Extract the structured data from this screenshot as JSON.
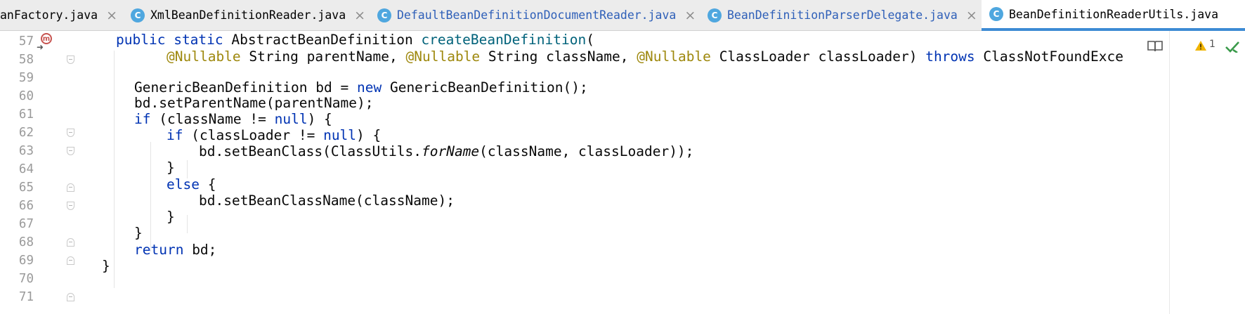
{
  "tabs": [
    {
      "label": "anFactory.java",
      "has_icon": false,
      "icon_letter": "",
      "active": false,
      "blue": false
    },
    {
      "label": "XmlBeanDefinitionReader.java",
      "has_icon": true,
      "icon_letter": "C",
      "active": false,
      "blue": false
    },
    {
      "label": "DefaultBeanDefinitionDocumentReader.java",
      "has_icon": true,
      "icon_letter": "C",
      "active": false,
      "blue": true
    },
    {
      "label": "BeanDefinitionParserDelegate.java",
      "has_icon": true,
      "icon_letter": "C",
      "active": false,
      "blue": true
    },
    {
      "label": "BeanDefinitionReaderUtils.java",
      "has_icon": true,
      "icon_letter": "C",
      "active": true,
      "blue": false
    }
  ],
  "close_glyph": "×",
  "gutter": {
    "line_numbers": [
      "57",
      "58",
      "59",
      "60",
      "61",
      "62",
      "63",
      "64",
      "65",
      "66",
      "67",
      "68",
      "69",
      "70",
      "71"
    ],
    "method_marker": "m"
  },
  "code": {
    "line_57": {
      "kw1": "public",
      "kw2": "static",
      "type": "AbstractBeanDefinition",
      "method": "createBeanDefinition",
      "open": "("
    },
    "line_58": {
      "ann1": "@Nullable",
      "p1": "String parentName,",
      "ann2": "@Nullable",
      "p2": "String className,",
      "ann3": "@Nullable",
      "p3": "ClassLoader classLoader)",
      "kw": "throws",
      "ex": "ClassNotFoundExce"
    },
    "line_60": {
      "pre": "GenericBeanDefinition bd = ",
      "kw": "new",
      "post": " GenericBeanDefinition();"
    },
    "line_61": {
      "text": "bd.setParentName(parentName);"
    },
    "line_62": {
      "kw": "if",
      "mid": " (className != ",
      "kw2": "null",
      "post": ") {"
    },
    "line_63": {
      "kw": "if",
      "mid": " (classLoader != ",
      "kw2": "null",
      "post": ") {"
    },
    "line_64": {
      "pre": "bd.setBeanClass(ClassUtils.",
      "static": "forName",
      "post": "(className, classLoader));"
    },
    "line_65": {
      "text": "}"
    },
    "line_66": {
      "kw": "else",
      "post": " {"
    },
    "line_67": {
      "text": "bd.setBeanClassName(className);"
    },
    "line_68": {
      "text": "}"
    },
    "line_69": {
      "text": "}"
    },
    "line_70": {
      "kw": "return",
      "post": " bd;"
    },
    "line_71": {
      "text": "}"
    }
  },
  "inspections": {
    "warning_count": "1",
    "icons": [
      "reader-mode-icon",
      "warning-icon",
      "check-icon"
    ]
  },
  "colors": {
    "keyword": "#0033b3",
    "annotation": "#9e880d",
    "method_declaration": "#00627a",
    "tab_accent": "#3d8bd4",
    "class_icon": "#4fa7df"
  }
}
